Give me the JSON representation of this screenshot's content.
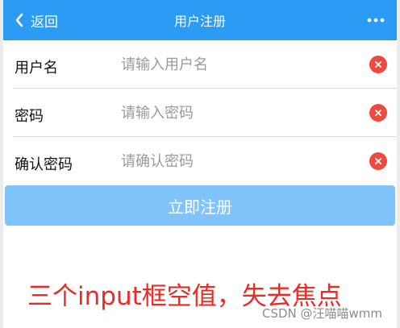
{
  "navbar": {
    "back_label": "返回",
    "title": "用户注册",
    "back_icon": "chevron-left-icon",
    "more_icon": "more-dots-icon"
  },
  "form": {
    "fields": [
      {
        "label": "用户名",
        "placeholder": "请输入用户名",
        "value": ""
      },
      {
        "label": "密码",
        "placeholder": "请输入密码",
        "value": ""
      },
      {
        "label": "确认密码",
        "placeholder": "请确认密码",
        "value": ""
      }
    ],
    "clear_icon": "clear-circle-icon",
    "submit_label": "立即注册"
  },
  "annotation": "三个input框空值，失去焦点",
  "watermark": "CSDN @汪喵喵wmm",
  "colors": {
    "navbar_bg": "#2b9bf5",
    "submit_bg": "#80c4fb",
    "clear_icon": "#ee4a3f",
    "annotation": "#ee2a24"
  }
}
